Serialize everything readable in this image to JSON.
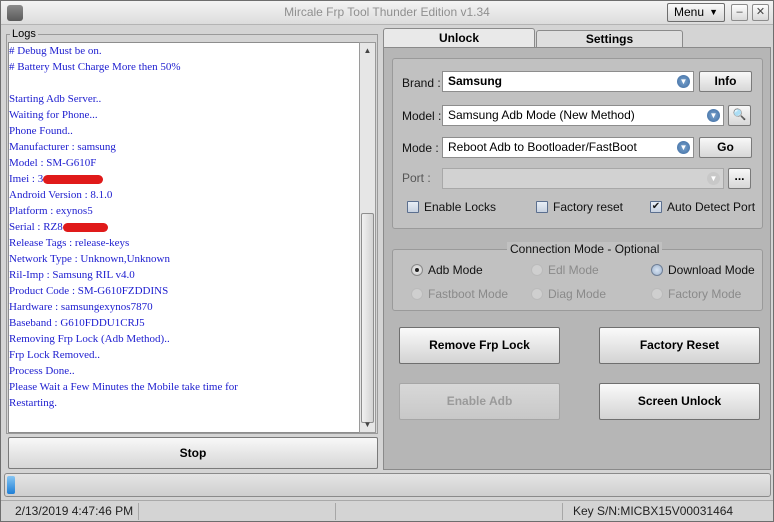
{
  "window": {
    "title": "Mircale Frp Tool Thunder Edition v1.34",
    "menu_label": "Menu"
  },
  "logs": {
    "label": "Logs",
    "lines": [
      {
        "text": " # Debug Must be on."
      },
      {
        "text": " # Battery Must Charge More then 50%"
      },
      {
        "text": ""
      },
      {
        "text": " Starting Adb Server.."
      },
      {
        "text": " Waiting for Phone..."
      },
      {
        "text": " Phone Found.."
      },
      {
        "text": " Manufacturer : samsung"
      },
      {
        "text": " Model : SM-G610F"
      },
      {
        "text": " Imei  : 3",
        "redact": 60
      },
      {
        "text": " Android Version : 8.1.0"
      },
      {
        "text": " Platform : exynos5"
      },
      {
        "text": " Serial : RZ8",
        "redact": 45
      },
      {
        "text": " Release Tags : release-keys"
      },
      {
        "text": " Network Type : Unknown,Unknown"
      },
      {
        "text": " Ril-Imp : Samsung RIL v4.0"
      },
      {
        "text": " Product Code : SM-G610FZDDINS"
      },
      {
        "text": " Hardware : samsungexynos7870"
      },
      {
        "text": " Baseband : G610FDDU1CRJ5"
      },
      {
        "text": " Removing Frp Lock (Adb Method).."
      },
      {
        "text": " Frp Lock Removed.."
      },
      {
        "text": " Process Done.."
      },
      {
        "text": " Please Wait a Few Minutes the Mobile take time for"
      },
      {
        "text": "Restarting."
      }
    ],
    "stop_label": "Stop"
  },
  "tabs": {
    "unlock": "Unlock",
    "settings": "Settings"
  },
  "form": {
    "brand_label": "Brand :",
    "brand_value": "Samsung",
    "info_label": "Info",
    "model_label": "Model :",
    "model_value": "Samsung Adb Mode (New Method)",
    "mode_label": "Mode :",
    "mode_value": "Reboot Adb to Bootloader/FastBoot",
    "go_label": "Go",
    "port_label": "Port :",
    "port_value": "",
    "port_btn": "...",
    "enable_locks": "Enable Locks",
    "factory_reset": "Factory reset",
    "auto_detect": "Auto Detect Port"
  },
  "connection": {
    "legend": "Connection Mode - Optional",
    "adb": "Adb Mode",
    "edl": "Edl Mode",
    "download": "Download Mode",
    "fastboot": "Fastboot Mode",
    "diag": "Diag Mode",
    "factory": "Factory Mode"
  },
  "actions": {
    "remove_frp": "Remove Frp Lock",
    "factory_reset": "Factory Reset",
    "enable_adb": "Enable Adb",
    "screen_unlock": "Screen Unlock"
  },
  "progress": {
    "value": 0.01
  },
  "status": {
    "datetime": "2/13/2019 4:47:46 PM",
    "key_sn": "Key S/N:MICBX15V00031464"
  },
  "colors": {
    "log_text": "#1c1ccf",
    "redaction": "#e01a1a",
    "progress": "#1f7fd6"
  }
}
